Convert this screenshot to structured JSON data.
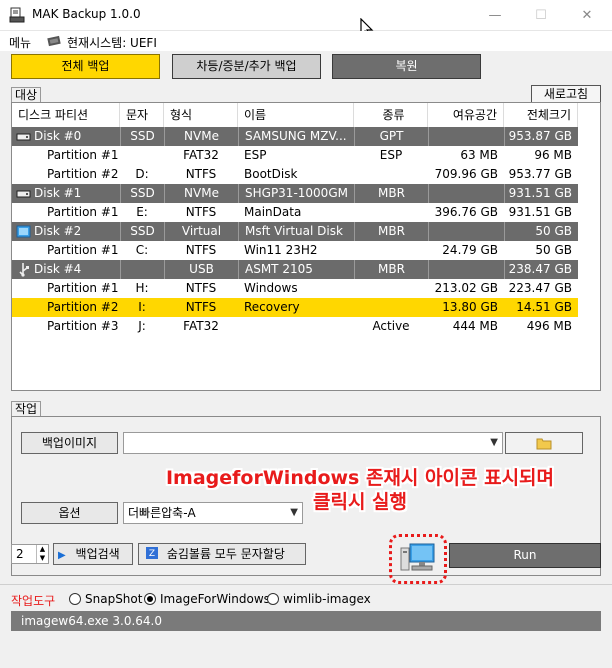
{
  "window": {
    "title": "MAK Backup 1.0.0"
  },
  "menu": {
    "menu_label": "메뉴",
    "system_label": "현재시스템: UEFI"
  },
  "modes": {
    "full": "전체 백업",
    "diff": "차등/증분/추가 백업",
    "restore": "복원"
  },
  "target": {
    "tab": "대상",
    "refresh": "새로고침",
    "columns": [
      "디스크 파티션",
      "문자",
      "형식",
      "이름",
      "종류",
      "여유공간",
      "전체크기"
    ],
    "rows": [
      {
        "kind": "disk",
        "icon": "hdd-icon",
        "cells": [
          "Disk #0",
          "SSD",
          "NVMe",
          "SAMSUNG MZV...",
          "GPT",
          "",
          "953.87 GB"
        ]
      },
      {
        "kind": "part",
        "cells": [
          "Partition #1",
          "",
          "FAT32",
          "ESP",
          "ESP",
          "63 MB",
          "96 MB"
        ]
      },
      {
        "kind": "part",
        "cells": [
          "Partition #2",
          "D:",
          "NTFS",
          "BootDisk",
          "",
          "709.96 GB",
          "953.77 GB"
        ]
      },
      {
        "kind": "disk",
        "icon": "hdd-icon",
        "cells": [
          "Disk #1",
          "SSD",
          "NVMe",
          "SHGP31-1000GM",
          "MBR",
          "",
          "931.51 GB"
        ]
      },
      {
        "kind": "part",
        "cells": [
          "Partition #1",
          "E:",
          "NTFS",
          "MainData",
          "",
          "396.76 GB",
          "931.51 GB"
        ]
      },
      {
        "kind": "disk",
        "icon": "virtual-disk-icon",
        "cells": [
          "Disk #2",
          "SSD",
          "Virtual",
          "Msft Virtual Disk",
          "MBR",
          "",
          "50 GB"
        ]
      },
      {
        "kind": "part",
        "cells": [
          "Partition #1",
          "C:",
          "NTFS",
          "Win11 23H2",
          "",
          "24.79 GB",
          "50 GB"
        ]
      },
      {
        "kind": "disk",
        "icon": "usb-icon",
        "cells": [
          "Disk #4",
          "",
          "USB",
          "ASMT 2105",
          "MBR",
          "",
          "238.47 GB"
        ]
      },
      {
        "kind": "part",
        "cells": [
          "Partition #1",
          "H:",
          "NTFS",
          "Windows",
          "",
          "213.02 GB",
          "223.47 GB"
        ]
      },
      {
        "kind": "sel",
        "cells": [
          "Partition #2",
          "I:",
          "NTFS",
          "Recovery",
          "",
          "13.80 GB",
          "14.51 GB"
        ]
      },
      {
        "kind": "part",
        "cells": [
          "Partition #3",
          "J:",
          "FAT32",
          "",
          "Active",
          "444 MB",
          "496 MB"
        ]
      }
    ]
  },
  "work": {
    "tab": "작업",
    "image_button": "백업이미지",
    "image_path": "",
    "options_button": "옵션",
    "options_value": "더빠른압축-A",
    "annotation_line1": "ImageforWindows 존재시 아이콘 표시되며",
    "annotation_line2": "클릭시 실행",
    "search_count": "2",
    "search_button": "백업검색",
    "assign_button": "숨김볼륨 모두 문자할당",
    "run_button": "Run"
  },
  "tools": {
    "label": "작업도구",
    "options": [
      {
        "label": "SnapShot",
        "selected": false
      },
      {
        "label": "ImageForWindows",
        "selected": true
      },
      {
        "label": "wimlib-imagex",
        "selected": false
      }
    ],
    "status": "imagew64.exe 3.0.64.0"
  },
  "colors": {
    "accent": "#ffd700",
    "disk_row": "#6b6b6b",
    "annotation": "#e81b1b"
  }
}
